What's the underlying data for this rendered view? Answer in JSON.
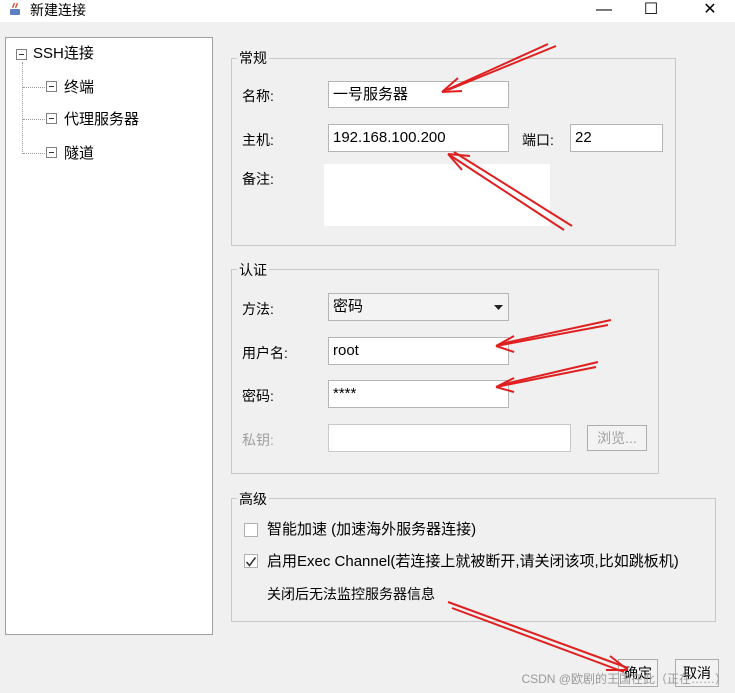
{
  "window": {
    "title": "新建连接",
    "buttons": {
      "minimize": "—",
      "maximize": "☐",
      "close": "✕"
    }
  },
  "tree": {
    "root": "SSH连接",
    "items": [
      "终端",
      "代理服务器",
      "隧道"
    ]
  },
  "general": {
    "legend": "常规",
    "name_label": "名称:",
    "name_value": "一号服务器",
    "host_label": "主机:",
    "host_value": "192.168.100.200",
    "port_label": "端口:",
    "port_value": "22",
    "note_label": "备注:",
    "note_value": ""
  },
  "auth": {
    "legend": "认证",
    "method_label": "方法:",
    "method_value": "密码",
    "user_label": "用户名:",
    "user_value": "root",
    "password_label": "密码:",
    "password_value": "****",
    "key_label": "私钥:",
    "key_value": "",
    "browse_label": "浏览..."
  },
  "advanced": {
    "legend": "高级",
    "accel_label": "智能加速 (加速海外服务器连接)",
    "accel_checked": false,
    "exec_label": "启用Exec Channel(若连接上就被断开,请关闭该项,比如跳板机)",
    "exec_checked": true,
    "exec_note": "关闭后无法监控服务器信息"
  },
  "footer": {
    "ok_label": "确定",
    "cancel_label": "取消",
    "watermark": "CSDN @欧剧的王国在此（正在……）"
  },
  "colors": {
    "annotation_arrow": "#e02020"
  }
}
